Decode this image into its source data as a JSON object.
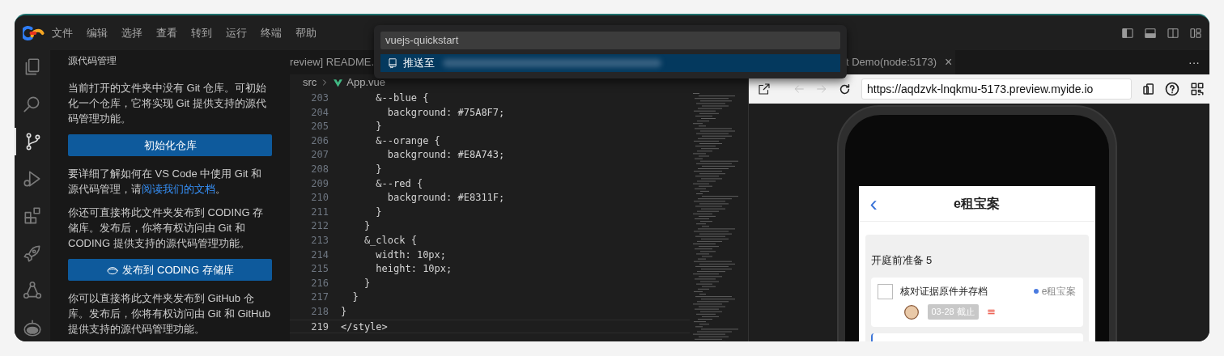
{
  "title_bar": {
    "menu": [
      "文件",
      "编辑",
      "选择",
      "查看",
      "转到",
      "运行",
      "终端",
      "帮助"
    ]
  },
  "activity_bar": [
    {
      "kind": "files",
      "selected": false
    },
    {
      "kind": "search",
      "selected": false
    },
    {
      "kind": "source-control",
      "selected": true
    },
    {
      "kind": "debug",
      "selected": false
    },
    {
      "kind": "extensions",
      "selected": false
    },
    {
      "kind": "rocket",
      "selected": false
    },
    {
      "kind": "share",
      "selected": false
    },
    {
      "kind": "robot",
      "selected": false
    }
  ],
  "sidebar": {
    "title": "源代码管理",
    "blocks": [
      {
        "kind": "text",
        "text": "当前打开的文件夹中没有 Git 仓库。可初始化一个仓库，它将实现 Git 提供支持的源代码管理功能。"
      },
      {
        "kind": "button",
        "label": "初始化仓库",
        "icon": false
      },
      {
        "kind": "text",
        "text": "要详细了解如何在 VS Code 中使用 Git 和源代码管理，请",
        "link": "阅读我们的文档",
        "after": "。"
      },
      {
        "kind": "text",
        "text": "你还可直接将此文件夹发布到 CODING 存储库。发布后，你将有权访问由 Git 和 CODING 提供支持的源代码管理功能。"
      },
      {
        "kind": "button",
        "label": "发布到 CODING 存储库",
        "icon": true
      },
      {
        "kind": "text",
        "text": "你可以直接将此文件夹发布到 GitHub 仓库。发布后，你将有权访问由 Git 和 GitHub 提供支持的源代码管理功能。"
      }
    ]
  },
  "editor": {
    "tab": "review] README.",
    "breadcrumb": [
      "src",
      "App.vue"
    ],
    "lines": [
      {
        "number": "203",
        "code": "      &--blue {",
        "selected": false
      },
      {
        "number": "204",
        "code": "        background: #75A8F7;",
        "selected": false
      },
      {
        "number": "205",
        "code": "      }",
        "selected": false
      },
      {
        "number": "206",
        "code": "      &--orange {",
        "selected": false
      },
      {
        "number": "207",
        "code": "        background: #E8A743;",
        "selected": false
      },
      {
        "number": "208",
        "code": "      }",
        "selected": false
      },
      {
        "number": "209",
        "code": "      &--red {",
        "selected": false
      },
      {
        "number": "210",
        "code": "        background: #E8311F;",
        "selected": false
      },
      {
        "number": "211",
        "code": "      }",
        "selected": false
      },
      {
        "number": "212",
        "code": "    }",
        "selected": false
      },
      {
        "number": "213",
        "code": "    &_clock {",
        "selected": false
      },
      {
        "number": "214",
        "code": "      width: 10px;",
        "selected": false
      },
      {
        "number": "215",
        "code": "      height: 10px;",
        "selected": false
      },
      {
        "number": "216",
        "code": "    }",
        "selected": false
      },
      {
        "number": "217",
        "code": "  }",
        "selected": false
      },
      {
        "number": "218",
        "code": "}",
        "selected": false
      },
      {
        "number": "219",
        "code": "</style>",
        "selected": true
      }
    ]
  },
  "quick_pick": {
    "value": "vuejs-quickstart",
    "items": [
      {
        "label": "推送至",
        "selected": true
      }
    ]
  },
  "preview": {
    "tab": "t Demo(node:5173)",
    "close": "×",
    "more": "···",
    "url": "https://aqdzvk-lnqkmu-5173.preview.myide.io",
    "back_disabled": true,
    "forward_disabled": true,
    "app": {
      "back": "‹",
      "title": "e租宝案",
      "section": "开庭前准备 5",
      "task": {
        "title": "核对证据原件并存档",
        "checked": false,
        "project": "e租宝案",
        "due": "03-28 截止"
      }
    }
  }
}
